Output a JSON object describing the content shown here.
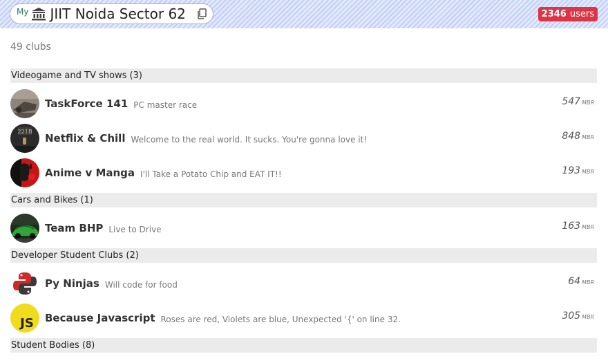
{
  "header": {
    "my_label": "My",
    "institution_name": "JIIT Noida Sector 62",
    "users_count": "2346",
    "users_label": "users"
  },
  "clubs_summary": "49 clubs",
  "member_unit": "MBR",
  "categories": [
    {
      "title": "Videogame and TV shows (3)",
      "clubs": [
        {
          "name": "TaskForce 141",
          "description": "PC master race",
          "members": "547"
        },
        {
          "name": "Netflix & Chill",
          "description": "Welcome to the real world. It sucks. You're gonna love it!",
          "members": "848"
        },
        {
          "name": "Anime v Manga",
          "description": "I'll Take a Potato Chip and EAT IT!!",
          "members": "193"
        }
      ]
    },
    {
      "title": "Cars and Bikes (1)",
      "clubs": [
        {
          "name": "Team BHP",
          "description": "Live to Drive",
          "members": "163"
        }
      ]
    },
    {
      "title": "Developer Student Clubs (2)",
      "clubs": [
        {
          "name": "Py Ninjas",
          "description": "Will code for food",
          "members": "64"
        },
        {
          "name": "Because Javascript",
          "description": "Roses are red, Violets are blue, Unexpected '{' on line 32.",
          "members": "305"
        }
      ]
    },
    {
      "title": "Student Bodies (8)",
      "clubs": []
    }
  ],
  "avatar_images": {
    "0": {
      "text": ""
    },
    "1": {
      "text": "221B"
    },
    "5": {
      "text": "JS"
    }
  },
  "colors": {
    "users_badge": "#dc3545",
    "topbar_stripe": "#c1cef7",
    "category_bg": "#ebebeb",
    "js_yellow": "#f0db1c"
  }
}
